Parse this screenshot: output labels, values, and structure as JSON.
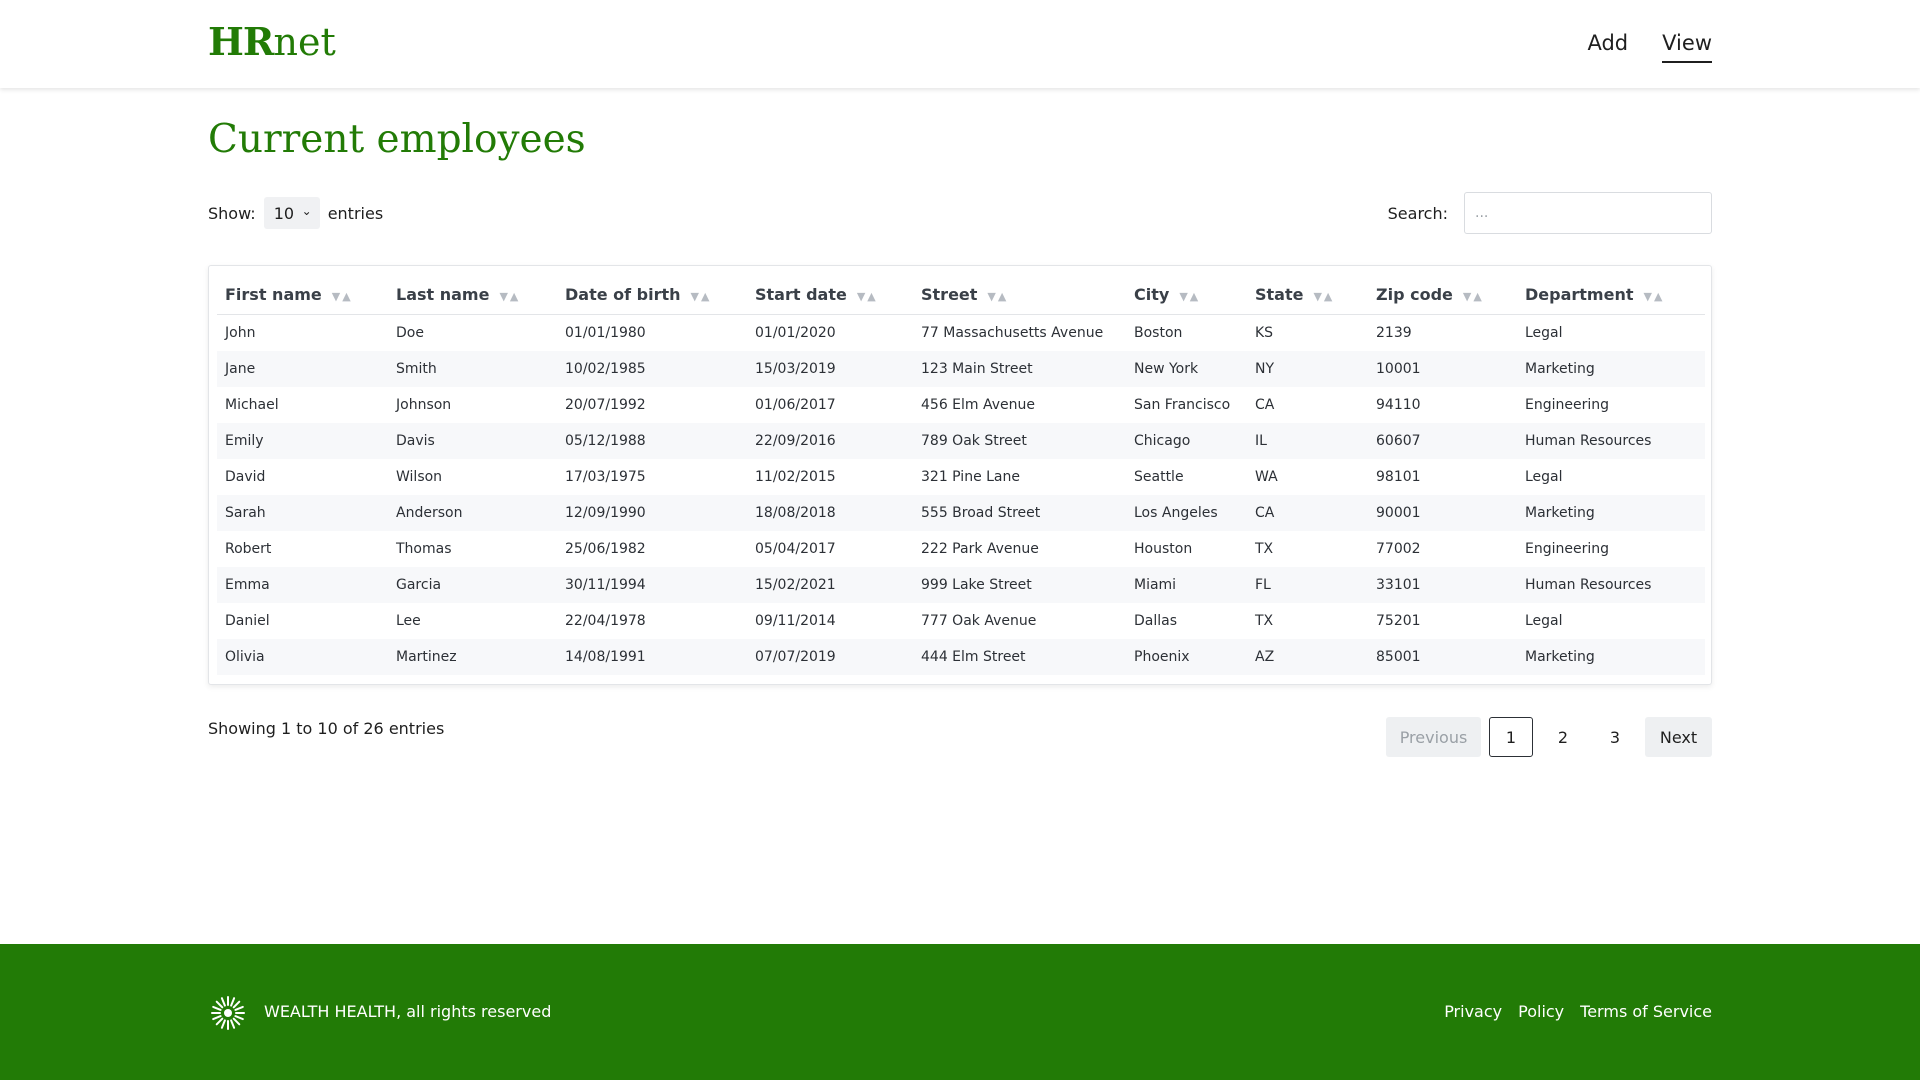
{
  "header": {
    "logo_bold": "HR",
    "logo_rest": "net",
    "nav": {
      "add": "Add",
      "view": "View"
    }
  },
  "page_title": "Current employees",
  "controls": {
    "show_label": "Show:",
    "entries_value": "10",
    "entries_label": "entries",
    "search_label": "Search:",
    "search_placeholder": "..."
  },
  "table": {
    "columns": [
      "First name",
      "Last name",
      "Date of birth",
      "Start date",
      "Street",
      "City",
      "State",
      "Zip code",
      "Department"
    ],
    "rows": [
      [
        "John",
        "Doe",
        "01/01/1980",
        "01/01/2020",
        "77 Massachusetts Avenue",
        "Boston",
        "KS",
        "2139",
        "Legal"
      ],
      [
        "Jane",
        "Smith",
        "10/02/1985",
        "15/03/2019",
        "123 Main Street",
        "New York",
        "NY",
        "10001",
        "Marketing"
      ],
      [
        "Michael",
        "Johnson",
        "20/07/1992",
        "01/06/2017",
        "456 Elm Avenue",
        "San Francisco",
        "CA",
        "94110",
        "Engineering"
      ],
      [
        "Emily",
        "Davis",
        "05/12/1988",
        "22/09/2016",
        "789 Oak Street",
        "Chicago",
        "IL",
        "60607",
        "Human Resources"
      ],
      [
        "David",
        "Wilson",
        "17/03/1975",
        "11/02/2015",
        "321 Pine Lane",
        "Seattle",
        "WA",
        "98101",
        "Legal"
      ],
      [
        "Sarah",
        "Anderson",
        "12/09/1990",
        "18/08/2018",
        "555 Broad Street",
        "Los Angeles",
        "CA",
        "90001",
        "Marketing"
      ],
      [
        "Robert",
        "Thomas",
        "25/06/1982",
        "05/04/2017",
        "222 Park Avenue",
        "Houston",
        "TX",
        "77002",
        "Engineering"
      ],
      [
        "Emma",
        "Garcia",
        "30/11/1994",
        "15/02/2021",
        "999 Lake Street",
        "Miami",
        "FL",
        "33101",
        "Human Resources"
      ],
      [
        "Daniel",
        "Lee",
        "22/04/1978",
        "09/11/2014",
        "777 Oak Avenue",
        "Dallas",
        "TX",
        "75201",
        "Legal"
      ],
      [
        "Olivia",
        "Martinez",
        "14/08/1991",
        "07/07/2019",
        "444 Elm Street",
        "Phoenix",
        "AZ",
        "85001",
        "Marketing"
      ]
    ]
  },
  "info_text": "Showing 1 to 10 of 26 entries",
  "pagination": {
    "previous": "Previous",
    "pages": [
      "1",
      "2",
      "3"
    ],
    "current": "1",
    "next": "Next"
  },
  "footer": {
    "copyright": "WEALTH HEALTH, all rights reserved",
    "links": [
      "Privacy",
      "Policy",
      "Terms of Service"
    ]
  },
  "colors": {
    "brand_green": "#227b06",
    "text": "#1f1f1f",
    "stripe": "#f7f8fa"
  },
  "icons": {
    "sort": "sort-arrows-icon",
    "select": "chevron-down-icon",
    "footer_logo": "wealth-health-logo-icon"
  }
}
